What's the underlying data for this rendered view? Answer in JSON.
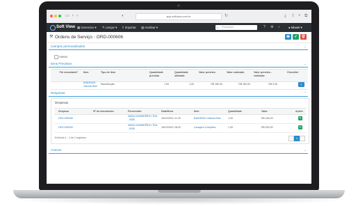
{
  "browser": {
    "url": "app.softview.com.br"
  },
  "app": {
    "brand": "Soft View",
    "menu": [
      {
        "icon": "building-icon",
        "label": "Gerenciar ▾"
      },
      {
        "icon": "edit-icon",
        "label": "Lançar ▾"
      },
      {
        "icon": "upload-icon",
        "label": "Importar"
      },
      {
        "icon": "chart-icon",
        "label": "Analisar ▾"
      }
    ],
    "search_placeholder": "Pesquisar",
    "user": "Misael ▾"
  },
  "page": {
    "title": "Ordens de Serviço",
    "separator": "›",
    "record": "ORD-000606",
    "actions": [
      {
        "name": "print",
        "glyph": "🖶",
        "color": "#2a8ccd"
      },
      {
        "name": "confirm",
        "glyph": "✔",
        "color": "#21a366"
      },
      {
        "name": "delete",
        "glyph": "🗑",
        "color": "#e04848"
      }
    ]
  },
  "custom_fields": {
    "title": "Campos personalizados",
    "checkbox_label": "Anexo"
  },
  "items": {
    "title": "Itens Previstos",
    "columns": [
      "Foi executado?",
      "Item",
      "Tipo de item",
      "Quantidade prevista",
      "Quantidade utilizada",
      "Valor previsto",
      "Valor realizado",
      "Valor previsto - realizado",
      "Checklist"
    ],
    "rows": [
      {
        "executed": "",
        "item": "B16DE000 Válvula Rele",
        "type": "Manutenção",
        "qty_planned": "1,00",
        "qty_used": "1,00",
        "value_planned": "R$ 180,00",
        "value_done": "R$ 180,00",
        "value_diff": "R$ 0,00",
        "checklist": ""
      }
    ]
  },
  "expenses": {
    "title": "Despesas",
    "panel_title": "Despesas",
    "columns": [
      "Despesa",
      "Nº do documento",
      "Fornecedor",
      "Data/Hora",
      "Item",
      "Quantidade",
      "Valor",
      "Ações"
    ],
    "rows": [
      {
        "expense": "DES-000038",
        "doc": "",
        "supplier": "NASA CAMINHÕES LTDA - BOB",
        "date": "18/12/2021 11:20",
        "item": "B16DE000 Válvula Rele",
        "qty": "1,00",
        "value": "R$ 180,00"
      },
      {
        "expense": "DES-000039",
        "doc": "",
        "supplier": "NASA CAMINHÕES LTDA - BOB",
        "date": "18/12/2021 18:42",
        "item": "Lavagem Completa",
        "qty": "1,00",
        "value": "R$ 200,00"
      }
    ],
    "pagination_info": "Exibindo 1 - 2 de 2 registros",
    "pages": [
      "‹",
      "1",
      "›"
    ]
  },
  "attachments": {
    "title": "Anexos"
  },
  "colors": {
    "accent": "#2a8ccd",
    "success": "#21a366",
    "danger": "#e04848",
    "topbar": "#2b2e33"
  }
}
